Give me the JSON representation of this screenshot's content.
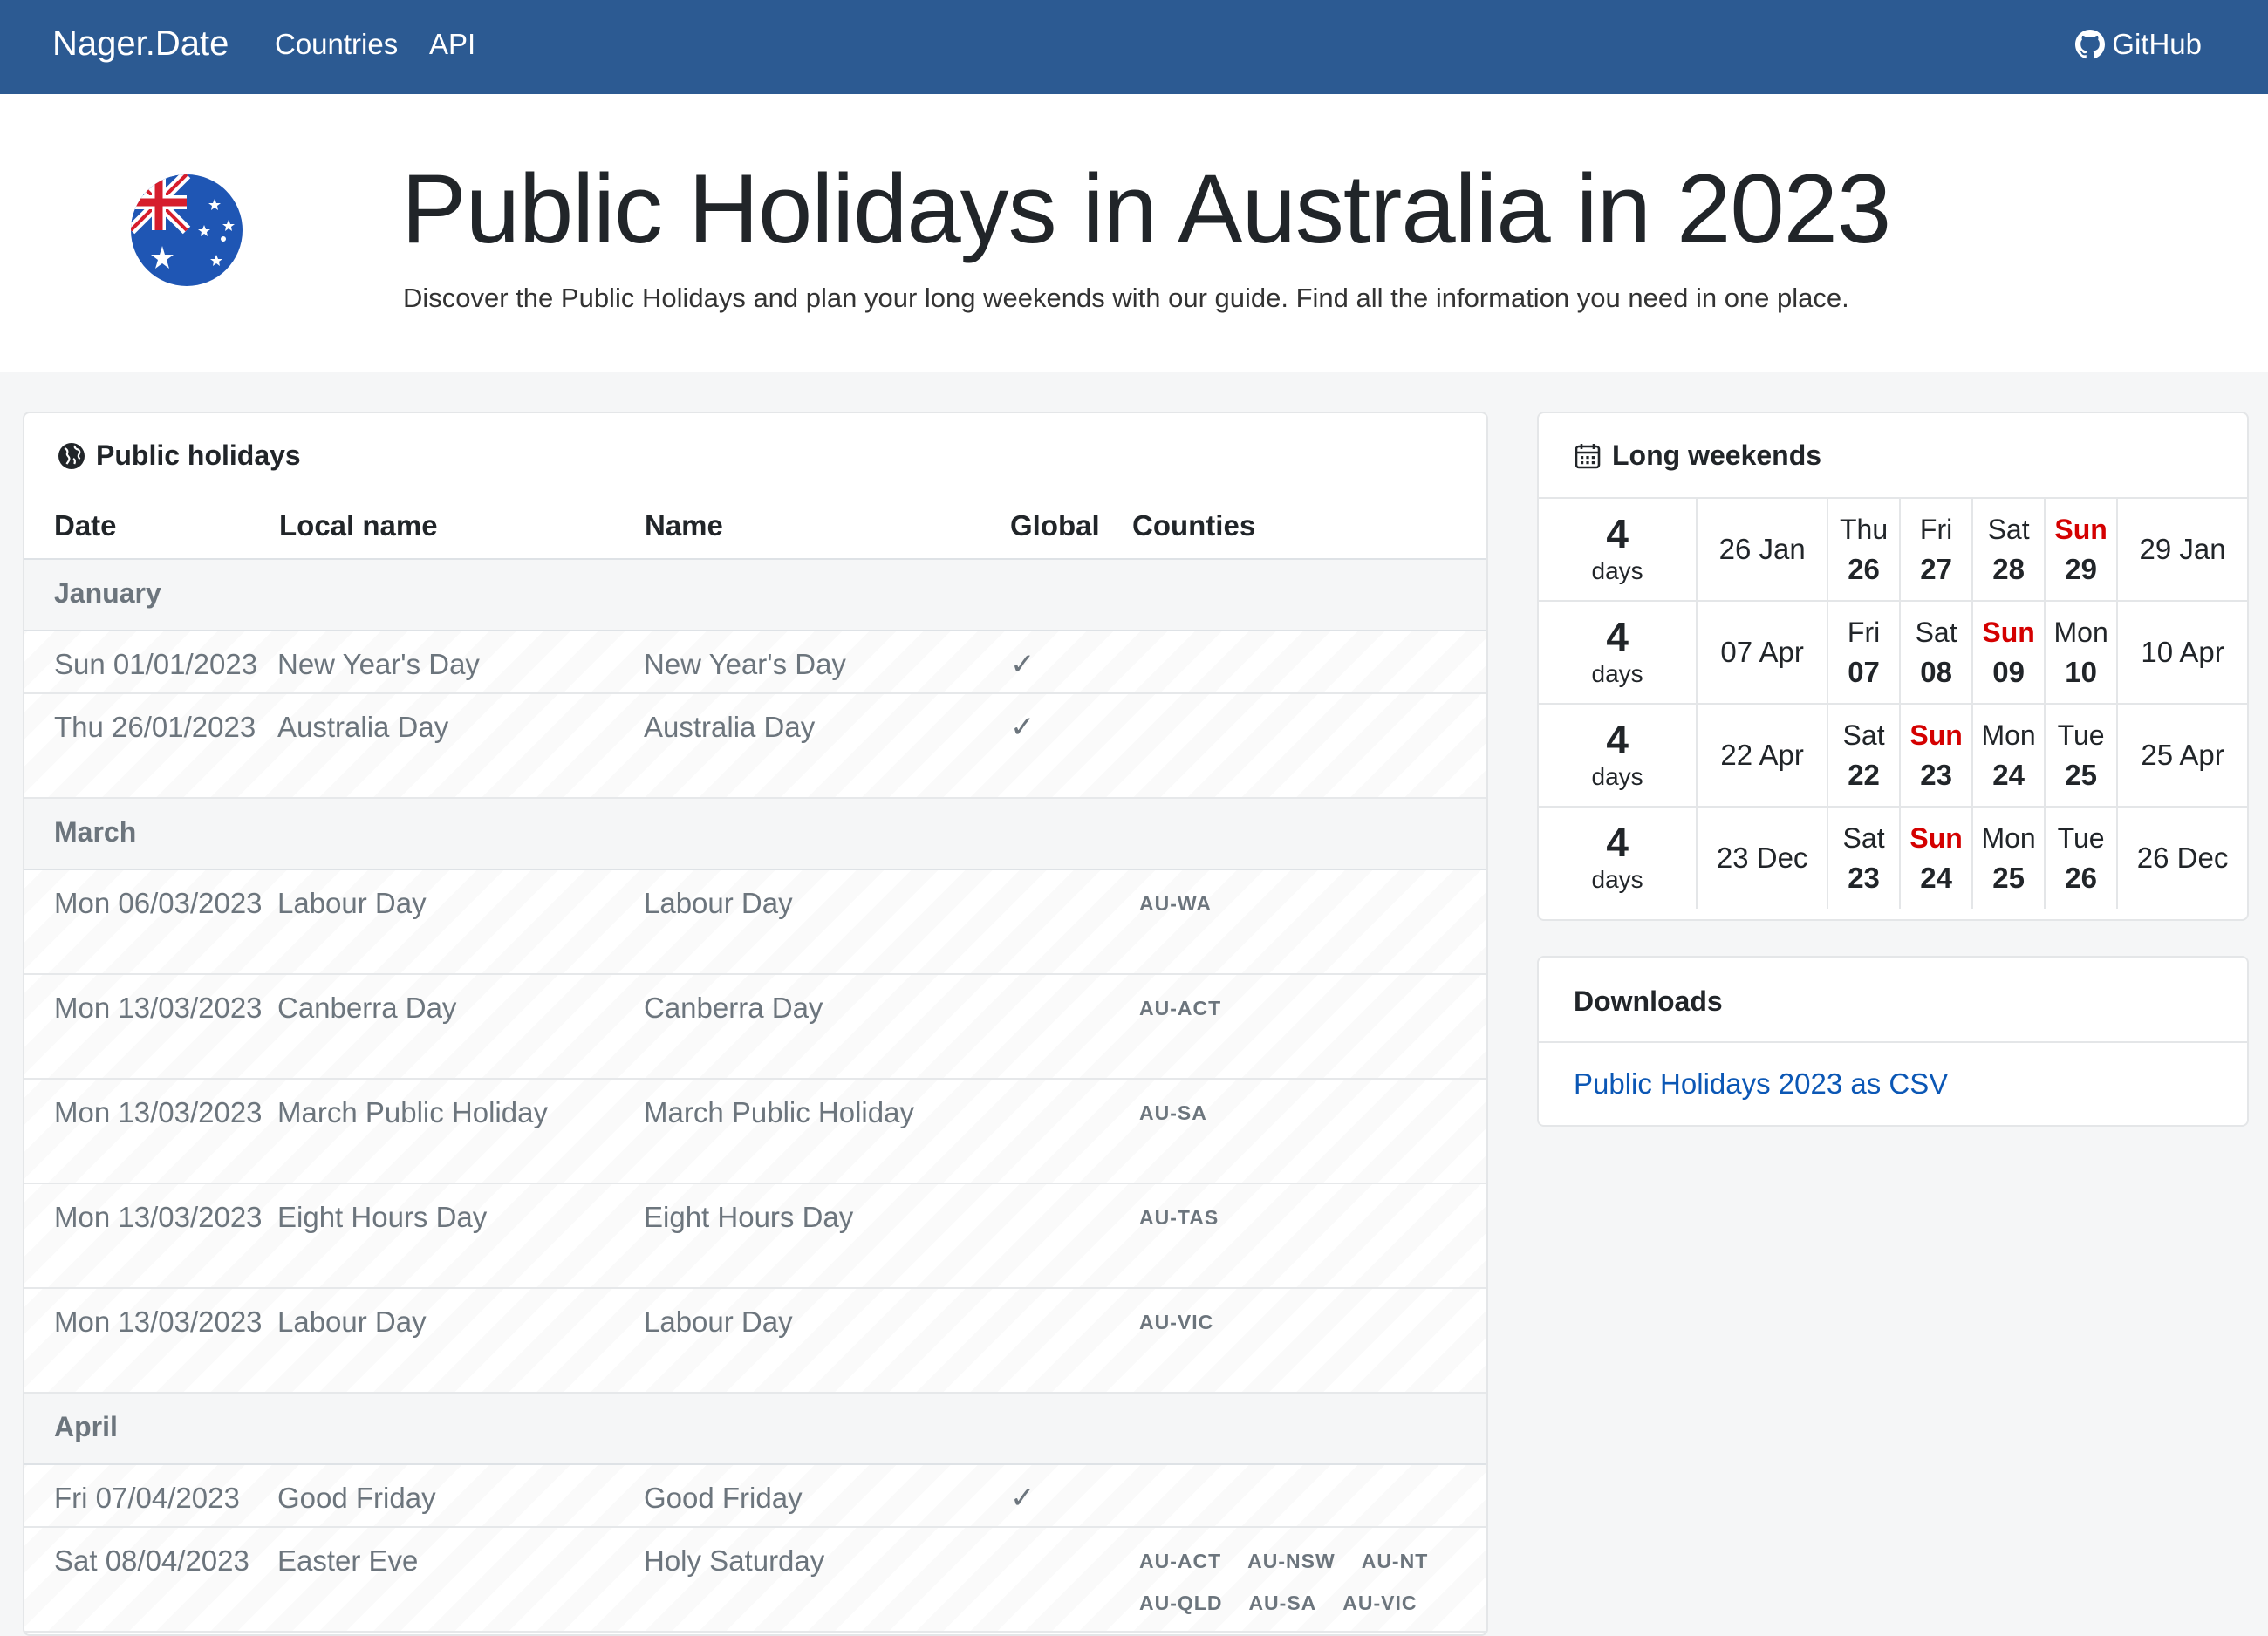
{
  "navbar": {
    "brand": "Nager.Date",
    "links": [
      "Countries",
      "API"
    ],
    "github": "GitHub",
    "background": "#2c5a92"
  },
  "hero": {
    "title": "Public Holidays in Australia in 2023",
    "subtitle": "Discover the Public Holidays and plan your long weekends with our guide. Find all the information you need in one place.",
    "flag_icon": "australia-flag-icon"
  },
  "holidays": {
    "title": "Public holidays",
    "columns": [
      "Date",
      "Local name",
      "Name",
      "Global",
      "Counties"
    ],
    "months": [
      {
        "name": "January",
        "rows": [
          {
            "date": "Sun 01/01/2023",
            "local": "New Year's Day",
            "name": "New Year's Day",
            "global": "✓",
            "counties": []
          },
          {
            "date": "Thu 26/01/2023",
            "local": "Australia Day",
            "name": "Australia Day",
            "global": "✓",
            "counties": []
          }
        ]
      },
      {
        "name": "March",
        "rows": [
          {
            "date": "Mon 06/03/2023",
            "local": "Labour Day",
            "name": "Labour Day",
            "global": "",
            "counties": [
              "AU-WA"
            ]
          },
          {
            "date": "Mon 13/03/2023",
            "local": "Canberra Day",
            "name": "Canberra Day",
            "global": "",
            "counties": [
              "AU-ACT"
            ]
          },
          {
            "date": "Mon 13/03/2023",
            "local": "March Public Holiday",
            "name": "March Public Holiday",
            "global": "",
            "counties": [
              "AU-SA"
            ]
          },
          {
            "date": "Mon 13/03/2023",
            "local": "Eight Hours Day",
            "name": "Eight Hours Day",
            "global": "",
            "counties": [
              "AU-TAS"
            ]
          },
          {
            "date": "Mon 13/03/2023",
            "local": "Labour Day",
            "name": "Labour Day",
            "global": "",
            "counties": [
              "AU-VIC"
            ]
          }
        ]
      },
      {
        "name": "April",
        "rows": [
          {
            "date": "Fri 07/04/2023",
            "local": "Good Friday",
            "name": "Good Friday",
            "global": "✓",
            "counties": []
          },
          {
            "date": "Sat 08/04/2023",
            "local": "Easter Eve",
            "name": "Holy Saturday",
            "global": "",
            "counties": [
              "AU-ACT",
              "AU-NSW",
              "AU-NT",
              "AU-QLD",
              "AU-SA",
              "AU-VIC"
            ]
          }
        ]
      }
    ]
  },
  "long_weekends": {
    "title": "Long weekends",
    "items": [
      {
        "count": "4",
        "unit": "days",
        "start": "26 Jan",
        "end": "29 Jan",
        "days": [
          {
            "dow": "Thu",
            "num": "26"
          },
          {
            "dow": "Fri",
            "num": "27"
          },
          {
            "dow": "Sat",
            "num": "28"
          },
          {
            "dow": "Sun",
            "num": "29"
          }
        ]
      },
      {
        "count": "4",
        "unit": "days",
        "start": "07 Apr",
        "end": "10 Apr",
        "days": [
          {
            "dow": "Fri",
            "num": "07"
          },
          {
            "dow": "Sat",
            "num": "08"
          },
          {
            "dow": "Sun",
            "num": "09"
          },
          {
            "dow": "Mon",
            "num": "10"
          }
        ]
      },
      {
        "count": "4",
        "unit": "days",
        "start": "22 Apr",
        "end": "25 Apr",
        "days": [
          {
            "dow": "Sat",
            "num": "22"
          },
          {
            "dow": "Sun",
            "num": "23"
          },
          {
            "dow": "Mon",
            "num": "24"
          },
          {
            "dow": "Tue",
            "num": "25"
          }
        ]
      },
      {
        "count": "4",
        "unit": "days",
        "start": "23 Dec",
        "end": "26 Dec",
        "days": [
          {
            "dow": "Sat",
            "num": "23"
          },
          {
            "dow": "Sun",
            "num": "24"
          },
          {
            "dow": "Mon",
            "num": "25"
          },
          {
            "dow": "Tue",
            "num": "26"
          }
        ]
      }
    ],
    "sunday_color": "#d40000"
  },
  "downloads": {
    "title": "Downloads",
    "link": "Public Holidays 2023 as CSV"
  }
}
